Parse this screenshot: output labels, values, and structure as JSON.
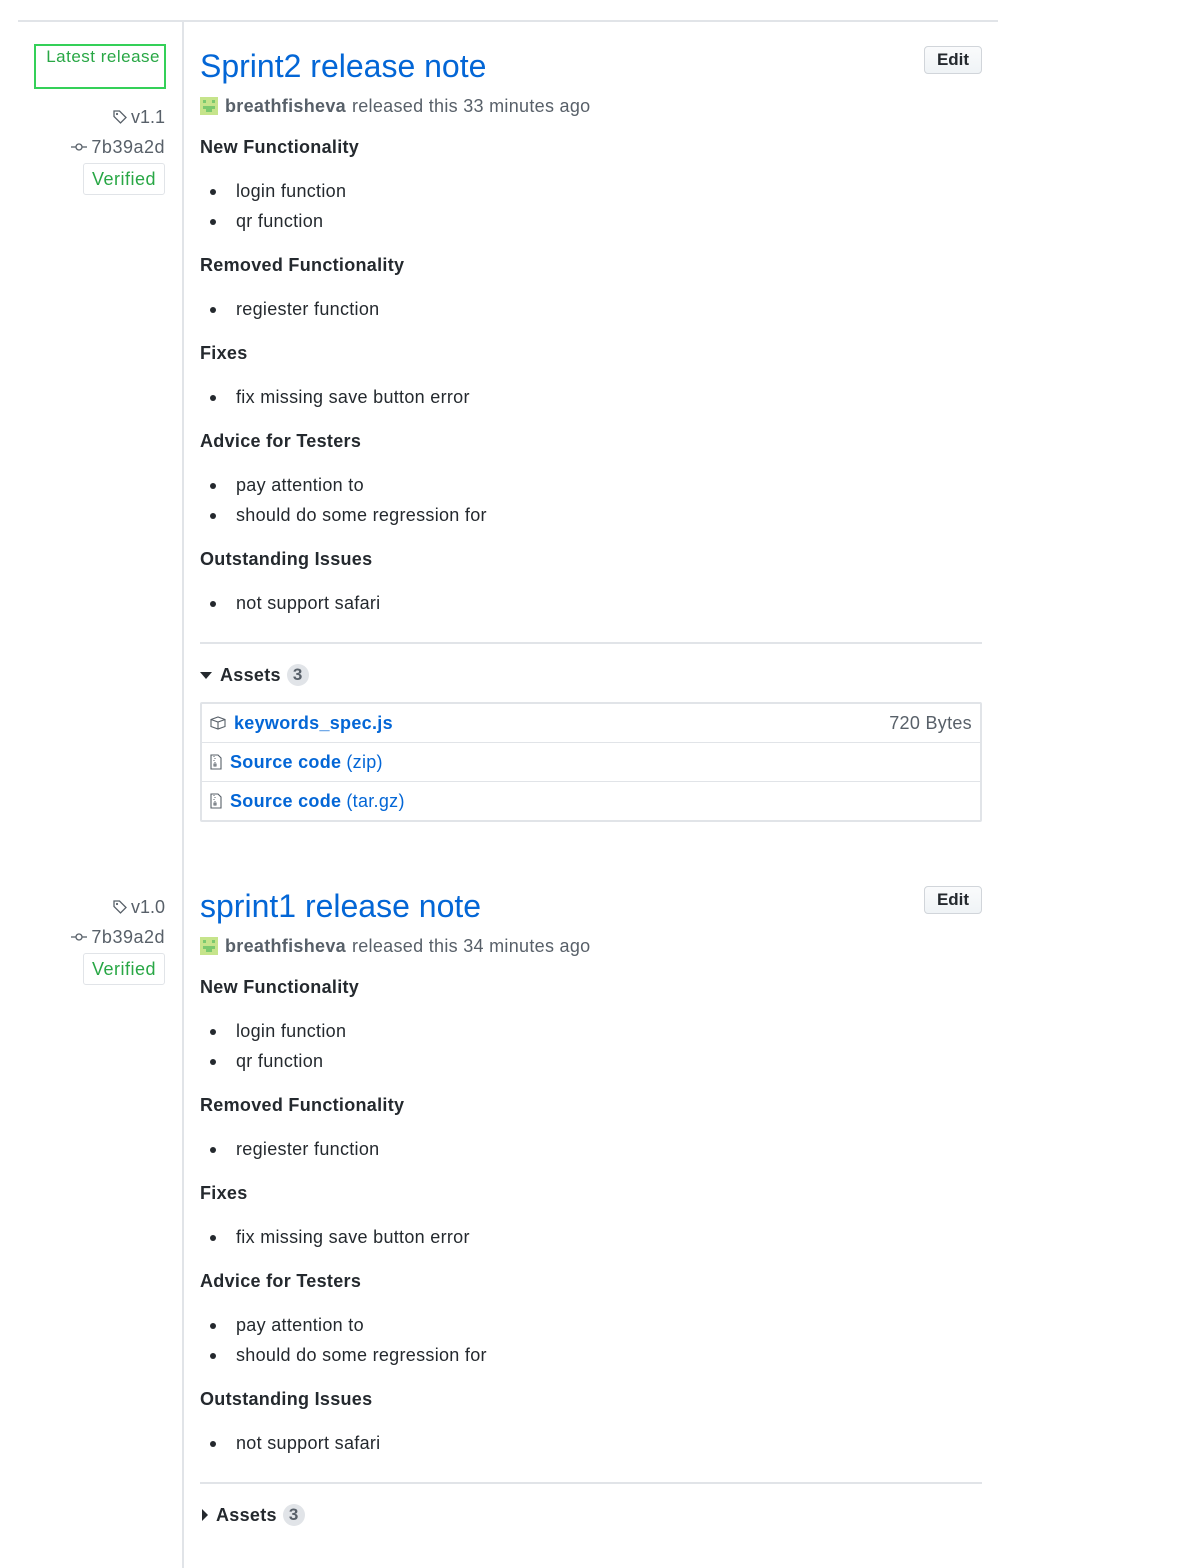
{
  "latest_badge": "Latest release",
  "releases": [
    {
      "tag": "v1.1",
      "commit": "7b39a2d",
      "verified": "Verified",
      "title": "Sprint2 release note",
      "author": "breathfisheva",
      "released_text": "released this 33 minutes ago",
      "edit_label": "Edit",
      "sections": [
        {
          "heading": "New Functionality",
          "items": [
            "login function",
            "qr function"
          ]
        },
        {
          "heading": "Removed Functionality",
          "items": [
            "regiester function"
          ]
        },
        {
          "heading": "Fixes",
          "items": [
            "fix missing save button error"
          ]
        },
        {
          "heading": "Advice for Testers",
          "items": [
            "pay attention to",
            "should do some regression for"
          ]
        },
        {
          "heading": "Outstanding Issues",
          "items": [
            "not support safari"
          ]
        }
      ],
      "assets": {
        "label": "Assets",
        "count": "3",
        "expanded": true,
        "files": [
          {
            "name": "keywords_spec.js",
            "ext": "",
            "size": "720 Bytes",
            "icon": "package-icon"
          },
          {
            "name": "Source code",
            "ext": "(zip)",
            "size": "",
            "icon": "file-zip-icon"
          },
          {
            "name": "Source code",
            "ext": "(tar.gz)",
            "size": "",
            "icon": "file-zip-icon"
          }
        ]
      }
    },
    {
      "tag": "v1.0",
      "commit": "7b39a2d",
      "verified": "Verified",
      "title": "sprint1 release note",
      "author": "breathfisheva",
      "released_text": "released this 34 minutes ago",
      "edit_label": "Edit",
      "sections": [
        {
          "heading": "New Functionality",
          "items": [
            "login function",
            "qr function"
          ]
        },
        {
          "heading": "Removed Functionality",
          "items": [
            "regiester function"
          ]
        },
        {
          "heading": "Fixes",
          "items": [
            "fix missing save button error"
          ]
        },
        {
          "heading": "Advice for Testers",
          "items": [
            "pay attention to",
            "should do some regression for"
          ]
        },
        {
          "heading": "Outstanding Issues",
          "items": [
            "not support safari"
          ]
        }
      ],
      "assets": {
        "label": "Assets",
        "count": "3",
        "expanded": false,
        "files": []
      }
    }
  ],
  "colors": {
    "link": "#0366d6",
    "verified": "#28a745",
    "muted": "#586069",
    "border": "#e1e4e8"
  }
}
